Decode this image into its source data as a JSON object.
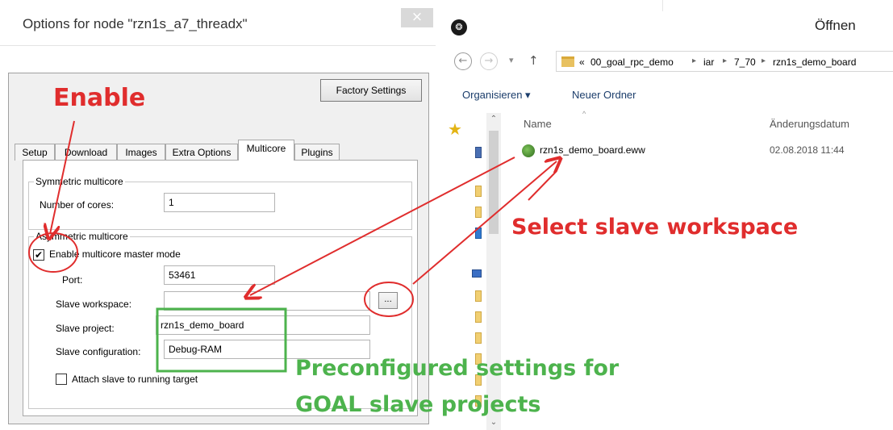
{
  "options_dialog": {
    "title": "Options for node \"rzn1s_a7_threadx\"",
    "close_glyph": "×",
    "factory_settings_label": "Factory Settings",
    "tabs": [
      "Setup",
      "Download",
      "Images",
      "Extra Options",
      "Multicore",
      "Plugins"
    ],
    "active_tab": "Multicore",
    "symmetric_group_label": "Symmetric multicore",
    "number_of_cores_label": "Number of cores:",
    "number_of_cores_value": "1",
    "asymmetric_group_label": "Asymmetric multicore",
    "enable_master_label": "Enable multicore master mode",
    "enable_master_checked": true,
    "port_label": "Port:",
    "port_value": "53461",
    "slave_workspace_label": "Slave workspace:",
    "slave_workspace_value": "",
    "browse_label": "...",
    "slave_project_label": "Slave project:",
    "slave_project_value": "rzn1s_demo_board",
    "slave_configuration_label": "Slave configuration:",
    "slave_configuration_value": "Debug-RAM",
    "attach_slave_label": "Attach slave to running target",
    "attach_slave_checked": false
  },
  "file_dialog": {
    "title": "Öffnen",
    "app_icon": "iar-logo-icon",
    "nav": {
      "back": "←",
      "forward": "→",
      "dropdown": "▾",
      "up": "↑"
    },
    "breadcrumb_prefix": "«",
    "breadcrumb": [
      "00_goal_rpc_demo",
      "iar",
      "7_70",
      "rzn1s_demo_board"
    ],
    "toolbar": {
      "organize_label": "Organisieren ▾",
      "new_folder_label": "Neuer Ordner"
    },
    "columns": {
      "name": "Name",
      "modified": "Änderungsdatum"
    },
    "files": [
      {
        "name": "rzn1s_demo_board.eww",
        "modified": "02.08.2018 11:44",
        "icon": "iar-workspace-icon"
      }
    ]
  },
  "annotations": {
    "enable": "Enable",
    "select_slave": "Select slave workspace",
    "preconfigured_line1": "Preconfigured settings for",
    "preconfigured_line2": "GOAL slave projects",
    "red": "#e02d2d",
    "green": "#4db34d"
  }
}
